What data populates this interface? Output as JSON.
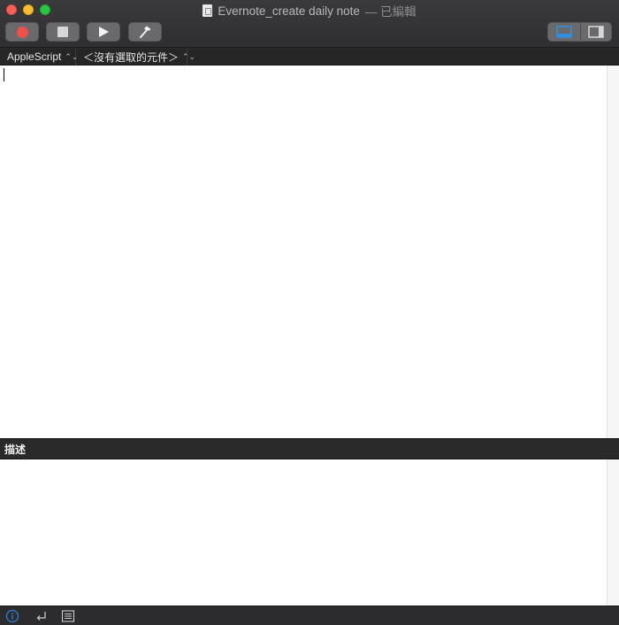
{
  "window": {
    "title": "Evernote_create daily note",
    "edited_suffix": "— 已編輯"
  },
  "toolbar": {
    "buttons": [
      {
        "name": "record",
        "icon": "record-icon",
        "color": "#f0504a"
      },
      {
        "name": "stop",
        "icon": "stop-icon"
      },
      {
        "name": "run",
        "icon": "play-icon"
      },
      {
        "name": "compile",
        "icon": "hammer-icon"
      }
    ],
    "view_toggle": [
      {
        "name": "bottom-pane",
        "icon": "bottom-panel-icon",
        "selected": true,
        "accent": "#2f8fe0"
      },
      {
        "name": "side-pane",
        "icon": "side-panel-icon",
        "selected": false
      }
    ]
  },
  "navbar": {
    "language": "AppleScript",
    "element": "＜沒有選取的元件＞"
  },
  "editor": {
    "content": ""
  },
  "description": {
    "header": "描述",
    "content": ""
  },
  "bottombar": {
    "icons": [
      "info-icon",
      "return-arrow-icon",
      "log-list-icon"
    ],
    "info_color": "#2a7fd6"
  }
}
